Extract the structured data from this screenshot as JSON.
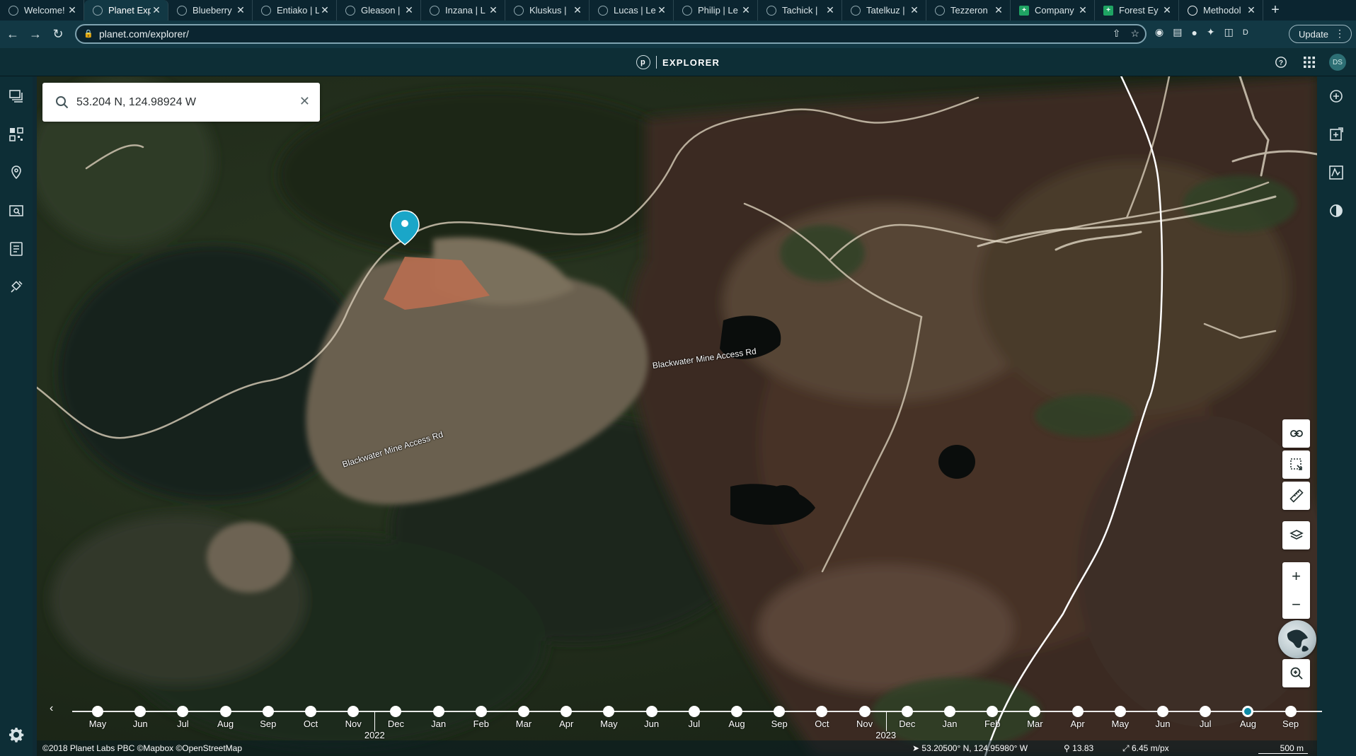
{
  "browser": {
    "tabs": [
      {
        "label": "Welcome!",
        "icon": "planet",
        "active": false
      },
      {
        "label": "Planet Explorer",
        "icon": "planet",
        "active": true
      },
      {
        "label": "Blueberry",
        "icon": "planet",
        "active": false
      },
      {
        "label": "Entiako | L",
        "icon": "planet",
        "active": false
      },
      {
        "label": "Gleason |",
        "icon": "planet",
        "active": false
      },
      {
        "label": "Inzana | L",
        "icon": "planet",
        "active": false
      },
      {
        "label": "Kluskus |",
        "icon": "planet",
        "active": false
      },
      {
        "label": "Lucas | Le",
        "icon": "planet",
        "active": false
      },
      {
        "label": "Philip | Le",
        "icon": "planet",
        "active": false
      },
      {
        "label": "Tachick |",
        "icon": "planet",
        "active": false
      },
      {
        "label": "Tatelkuz |",
        "icon": "planet",
        "active": false
      },
      {
        "label": "Tezzeron",
        "icon": "planet",
        "active": false
      },
      {
        "label": "Company",
        "icon": "sheet",
        "active": false
      },
      {
        "label": "Forest Ey",
        "icon": "sheet",
        "active": false
      },
      {
        "label": "Methodol",
        "icon": "globe",
        "active": false
      }
    ],
    "url": "planet.com/explorer/",
    "profile_initial": "D",
    "update_label": "Update"
  },
  "header": {
    "logo_letter": "p",
    "title": "EXPLORER",
    "avatar_initials": "DS"
  },
  "search": {
    "value": "53.204 N, 124.98924 W",
    "placeholder": "Search"
  },
  "map": {
    "road_labels": [
      "Blackwater Mine Access Rd",
      "Blackwater Mine Access Rd"
    ],
    "marker_color": "#1aa6c8"
  },
  "timeline": {
    "months": [
      "May",
      "Jun",
      "Jul",
      "Aug",
      "Sep",
      "Oct",
      "Nov",
      "Dec",
      "Jan",
      "Feb",
      "Mar",
      "Apr",
      "May",
      "Jun",
      "Jul",
      "Aug",
      "Sep",
      "Oct",
      "Nov",
      "Dec",
      "Jan",
      "Feb",
      "Mar",
      "Apr",
      "May",
      "Jun",
      "Jul",
      "Aug",
      "Sep"
    ],
    "years": [
      "2022",
      "2023"
    ],
    "selected_month": "Aug",
    "selected_index": 27
  },
  "footer": {
    "attribution": "©2018 Planet Labs PBC ©Mapbox ©OpenStreetMap",
    "coordinates": "53.20500° N, 124.95980° W",
    "zoom_level": "13.83",
    "resolution": "6.45 m/px",
    "scale": "500 m"
  },
  "colors": {
    "chrome_bg": "#0b2530",
    "app_bg": "#0d2e36",
    "accent": "#0c8aa6"
  }
}
